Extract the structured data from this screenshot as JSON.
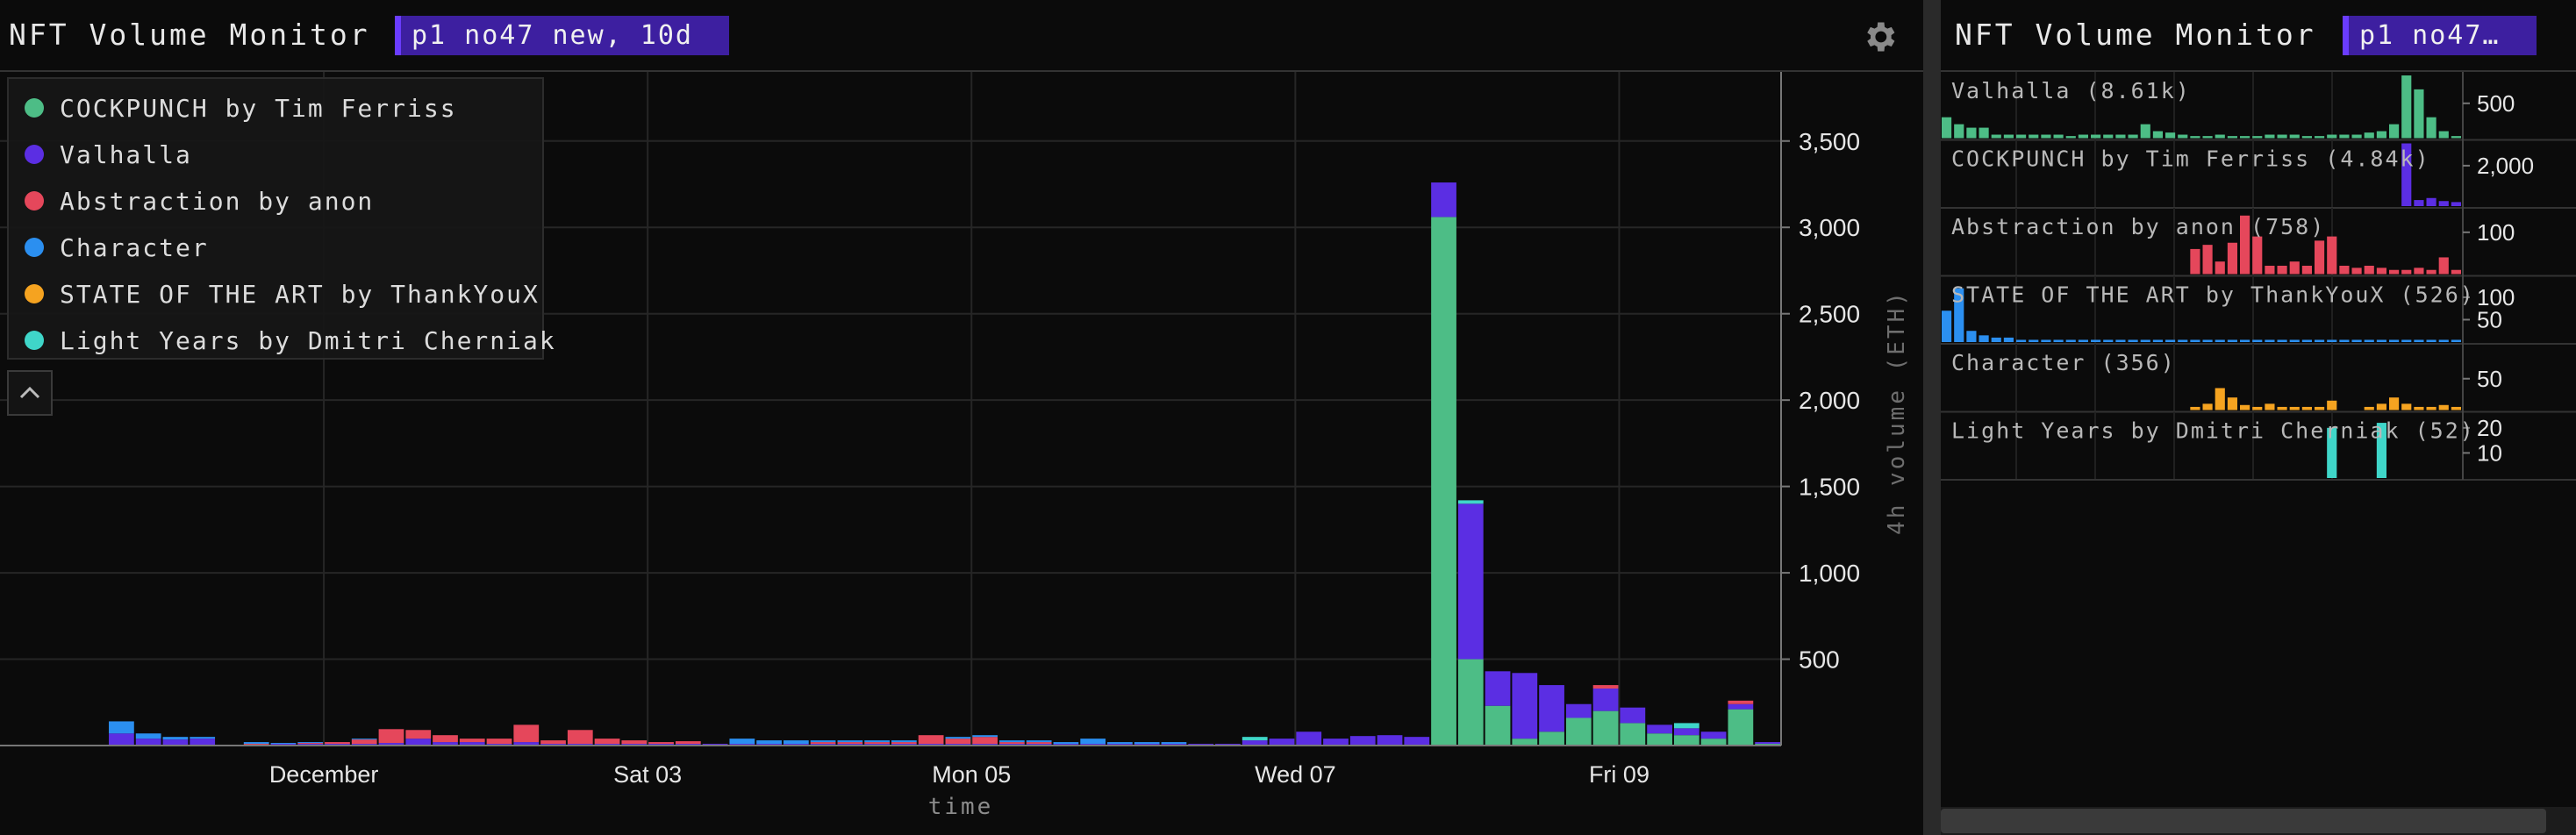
{
  "left_panel": {
    "title": "NFT Volume Monitor",
    "tag": "p1 no47 new, 10d"
  },
  "right_panel": {
    "title": "NFT Volume Monitor",
    "tag": "p1 no47…"
  },
  "icons": {
    "settings": "gear-icon",
    "collapse": "chevron-up-icon"
  },
  "colors": {
    "background": "#0b0b0b",
    "cockpunch": "#4dbd86",
    "valhalla": "#5b2ee3",
    "abstraction": "#e5475b",
    "character": "#2b8ff0",
    "state_of_the_art": "#f5a320",
    "light_years": "#3fd6c9"
  },
  "legend": [
    {
      "label": "COCKPUNCH by Tim Ferriss",
      "color": "#4dbd86"
    },
    {
      "label": "Valhalla",
      "color": "#5b2ee3"
    },
    {
      "label": "Abstraction by anon",
      "color": "#e5475b"
    },
    {
      "label": "Character",
      "color": "#2b8ff0"
    },
    {
      "label": "STATE OF THE ART by ThankYouX",
      "color": "#f5a320"
    },
    {
      "label": "Light Years by Dmitri Cherniak",
      "color": "#3fd6c9"
    }
  ],
  "chart_data": [
    {
      "type": "bar",
      "stacked": true,
      "xlabel": "time",
      "ylabel": "4h volume (ETH)",
      "ylim": [
        0,
        3900
      ],
      "yticks": [
        500,
        1000,
        1500,
        2000,
        2500,
        3000,
        3500
      ],
      "ytick_labels": [
        "500",
        "1,000",
        "1,500",
        "2,000",
        "2,500",
        "3,000",
        "3,500"
      ],
      "xticks": [
        {
          "label": "December",
          "bin": 12
        },
        {
          "label": "Sat 03",
          "bin": 24
        },
        {
          "label": "Mon 05",
          "bin": 36
        },
        {
          "label": "Wed 07",
          "bin": 48
        },
        {
          "label": "Fri 09",
          "bin": 60
        }
      ],
      "x_bins": 66,
      "bar_start_bin": 4,
      "grid": true,
      "legend_position": "top-left",
      "series": [
        {
          "name": "COCKPUNCH by Tim Ferriss",
          "color": "#4dbd86",
          "values": [
            0,
            0,
            0,
            0,
            0,
            0,
            0,
            0,
            0,
            0,
            0,
            0,
            0,
            0,
            0,
            0,
            0,
            0,
            0,
            0,
            0,
            0,
            0,
            0,
            0,
            0,
            0,
            0,
            0,
            0,
            0,
            0,
            0,
            0,
            0,
            0,
            0,
            0,
            0,
            0,
            0,
            0,
            0,
            0,
            0,
            0,
            0,
            0,
            0,
            3060,
            500,
            230,
            40,
            80,
            160,
            200,
            130,
            70,
            60,
            40,
            210,
            10
          ]
        },
        {
          "name": "Valhalla",
          "color": "#5b2ee3",
          "values": [
            70,
            40,
            35,
            40,
            0,
            5,
            10,
            10,
            10,
            10,
            15,
            40,
            20,
            20,
            10,
            20,
            10,
            10,
            10,
            10,
            10,
            10,
            10,
            10,
            10,
            10,
            10,
            10,
            10,
            10,
            10,
            10,
            10,
            10,
            10,
            10,
            10,
            10,
            10,
            10,
            10,
            10,
            30,
            40,
            80,
            40,
            55,
            60,
            50,
            200,
            900,
            200,
            380,
            270,
            80,
            130,
            90,
            50,
            40,
            40,
            30,
            10
          ]
        },
        {
          "name": "Abstraction by anon",
          "color": "#e5475b",
          "values": [
            0,
            0,
            0,
            0,
            0,
            5,
            0,
            5,
            10,
            25,
            80,
            50,
            40,
            20,
            30,
            100,
            20,
            80,
            30,
            20,
            10,
            15,
            0,
            0,
            0,
            0,
            10,
            10,
            10,
            10,
            50,
            30,
            40,
            10,
            10,
            0,
            0,
            0,
            0,
            0,
            0,
            0,
            0,
            0,
            0,
            0,
            0,
            0,
            0,
            0,
            0,
            0,
            0,
            0,
            0,
            20,
            0,
            0,
            0,
            0,
            20,
            0
          ]
        },
        {
          "name": "Character",
          "color": "#2b8ff0",
          "values": [
            70,
            30,
            15,
            10,
            0,
            10,
            5,
            5,
            0,
            5,
            0,
            0,
            0,
            0,
            0,
            0,
            0,
            0,
            0,
            0,
            0,
            0,
            0,
            30,
            20,
            20,
            10,
            10,
            10,
            10,
            0,
            10,
            10,
            10,
            10,
            10,
            30,
            10,
            10,
            10,
            0,
            0,
            0,
            0,
            0,
            0,
            0,
            0,
            0,
            0,
            0,
            0,
            0,
            0,
            0,
            0,
            0,
            0,
            0,
            0,
            0,
            0
          ]
        },
        {
          "name": "STATE OF THE ART by ThankYouX",
          "color": "#f5a320",
          "values": [
            0,
            0,
            0,
            0,
            0,
            0,
            0,
            0,
            0,
            0,
            0,
            0,
            0,
            0,
            0,
            0,
            0,
            0,
            0,
            0,
            0,
            0,
            0,
            0,
            0,
            0,
            0,
            0,
            0,
            0,
            0,
            0,
            0,
            0,
            0,
            0,
            0,
            0,
            0,
            0,
            0,
            0,
            0,
            0,
            0,
            0,
            0,
            0,
            0,
            0,
            0,
            0,
            0,
            0,
            0,
            0,
            0,
            0,
            0,
            0,
            0,
            0
          ]
        },
        {
          "name": "Light Years by Dmitri Cherniak",
          "color": "#3fd6c9",
          "values": [
            0,
            0,
            0,
            0,
            0,
            0,
            0,
            0,
            0,
            0,
            0,
            0,
            0,
            0,
            0,
            0,
            0,
            0,
            0,
            0,
            0,
            0,
            0,
            0,
            0,
            0,
            0,
            0,
            0,
            0,
            0,
            0,
            0,
            0,
            0,
            0,
            0,
            0,
            0,
            0,
            0,
            0,
            20,
            0,
            0,
            0,
            0,
            0,
            0,
            0,
            20,
            0,
            0,
            0,
            0,
            0,
            0,
            0,
            30,
            0,
            0,
            0
          ]
        }
      ]
    },
    {
      "type": "bar",
      "title": "Valhalla (8.61k)",
      "color": "#4dbd86",
      "ylim": [
        0,
        900
      ],
      "yticks": [
        500
      ],
      "ytick_labels": [
        "500"
      ],
      "values": [
        300,
        200,
        150,
        150,
        50,
        50,
        50,
        50,
        50,
        50,
        30,
        50,
        50,
        50,
        50,
        50,
        200,
        100,
        80,
        50,
        30,
        30,
        50,
        30,
        30,
        30,
        50,
        50,
        50,
        30,
        30,
        50,
        50,
        50,
        80,
        100,
        200,
        900,
        700,
        300,
        100,
        30
      ]
    },
    {
      "type": "bar",
      "title": "COCKPUNCH by Tim Ferriss (4.84k)",
      "color": "#5b2ee3",
      "ylim": [
        0,
        3100
      ],
      "yticks": [
        2000
      ],
      "ytick_labels": [
        "2,000"
      ],
      "values": [
        0,
        0,
        0,
        0,
        0,
        0,
        0,
        0,
        0,
        0,
        0,
        0,
        0,
        0,
        0,
        0,
        0,
        0,
        0,
        0,
        0,
        0,
        0,
        0,
        0,
        0,
        0,
        0,
        0,
        0,
        0,
        0,
        0,
        0,
        0,
        0,
        0,
        3100,
        300,
        400,
        250,
        200
      ]
    },
    {
      "type": "bar",
      "title": "Abstraction by anon (758)",
      "color": "#e5475b",
      "ylim": [
        0,
        150
      ],
      "yticks": [
        100
      ],
      "ytick_labels": [
        "100"
      ],
      "values": [
        0,
        0,
        0,
        0,
        0,
        0,
        0,
        0,
        0,
        0,
        0,
        0,
        0,
        0,
        0,
        0,
        0,
        0,
        0,
        0,
        60,
        70,
        30,
        75,
        140,
        90,
        20,
        20,
        30,
        20,
        80,
        90,
        20,
        15,
        20,
        15,
        10,
        10,
        15,
        10,
        40,
        10
      ]
    },
    {
      "type": "bar",
      "title": "STATE OF THE ART by ThankYouX (526)",
      "color": "#2b8ff0",
      "ylim": [
        0,
        140
      ],
      "yticks": [
        100,
        50
      ],
      "ytick_labels": [
        "100",
        "50"
      ],
      "values": [
        70,
        120,
        25,
        15,
        10,
        10,
        5,
        5,
        5,
        5,
        5,
        5,
        5,
        5,
        5,
        5,
        5,
        5,
        5,
        5,
        5,
        5,
        5,
        5,
        5,
        5,
        5,
        5,
        5,
        5,
        5,
        5,
        5,
        5,
        5,
        5,
        5,
        5,
        5,
        5,
        5,
        5
      ]
    },
    {
      "type": "bar",
      "title": "Character (356)",
      "color": "#f5a320",
      "ylim": [
        0,
        100
      ],
      "yticks": [
        50
      ],
      "ytick_labels": [
        "50"
      ],
      "values": [
        0,
        0,
        0,
        0,
        0,
        0,
        0,
        0,
        0,
        0,
        0,
        0,
        0,
        0,
        0,
        0,
        0,
        0,
        0,
        0,
        5,
        10,
        35,
        20,
        8,
        5,
        10,
        5,
        5,
        5,
        5,
        15,
        0,
        0,
        5,
        10,
        20,
        10,
        5,
        5,
        8,
        5
      ]
    },
    {
      "type": "bar",
      "title": "Light Years by Dmitri Cherniak (52)",
      "color": "#3fd6c9",
      "ylim": [
        0,
        25
      ],
      "yticks": [
        20,
        10
      ],
      "ytick_labels": [
        "20",
        "10"
      ],
      "values": [
        0,
        0,
        0,
        0,
        0,
        0,
        0,
        0,
        0,
        0,
        0,
        0,
        0,
        0,
        0,
        0,
        0,
        0,
        0,
        0,
        0,
        0,
        0,
        0,
        0,
        0,
        0,
        0,
        0,
        0,
        0,
        20,
        0,
        0,
        0,
        22,
        0,
        0,
        0,
        0,
        0,
        0
      ]
    }
  ]
}
